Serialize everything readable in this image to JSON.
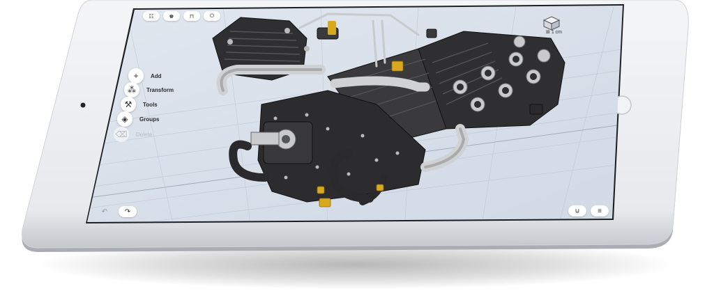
{
  "toolbar_top": {
    "items": [
      {
        "name": "grid-menu-icon",
        "glyph": "☷"
      },
      {
        "name": "learn-icon",
        "glyph": "♚"
      },
      {
        "name": "export-icon",
        "glyph": "⊓"
      },
      {
        "name": "power-icon",
        "glyph": "⏻"
      }
    ]
  },
  "tools": [
    {
      "label": "Add",
      "icon": "plus-icon",
      "glyph": "+",
      "enabled": true
    },
    {
      "label": "Transform",
      "icon": "transform-icon",
      "glyph": "⁂",
      "enabled": true
    },
    {
      "label": "Tools",
      "icon": "wrench-icon",
      "glyph": "⚒",
      "enabled": true
    },
    {
      "label": "Groups",
      "icon": "layers-icon",
      "glyph": "◈",
      "enabled": true
    },
    {
      "label": "Delete",
      "icon": "trash-icon",
      "glyph": "⌫",
      "enabled": false
    }
  ],
  "scale_label": "1 cm",
  "bottom_left": {
    "undo_glyph": "↶",
    "redo_glyph": "↷"
  },
  "bottom_right": {
    "snap_glyph": "⊍",
    "settings_glyph": "≡"
  },
  "colors": {
    "background": "#cfd8e4",
    "engine_dark": "#2f2f31",
    "engine_metal": "#c9cacc",
    "brass": "#d8a91e"
  }
}
